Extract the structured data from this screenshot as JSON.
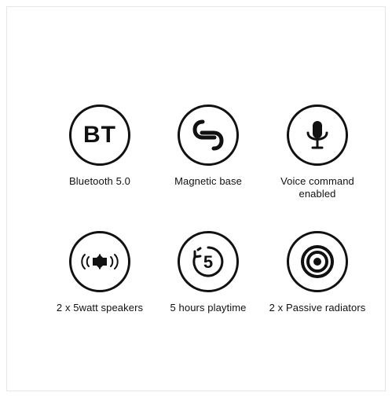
{
  "features": [
    {
      "label": "Bluetooth 5.0",
      "icon": "bluetooth-icon",
      "icon_text": "BT"
    },
    {
      "label": "Magnetic base",
      "icon": "magnet-icon"
    },
    {
      "label": "Voice command\nenabled",
      "icon": "microphone-icon"
    },
    {
      "label": "2 x 5watt speakers",
      "icon": "speakers-icon"
    },
    {
      "label": "5 hours playtime",
      "icon": "playtime-icon",
      "icon_text": "5"
    },
    {
      "label": "2 x Passive radiators",
      "icon": "passive-radiator-icon"
    }
  ],
  "colors": {
    "icon_stroke": "#111111",
    "background": "#ffffff",
    "frame_border": "#e6e6e6"
  }
}
